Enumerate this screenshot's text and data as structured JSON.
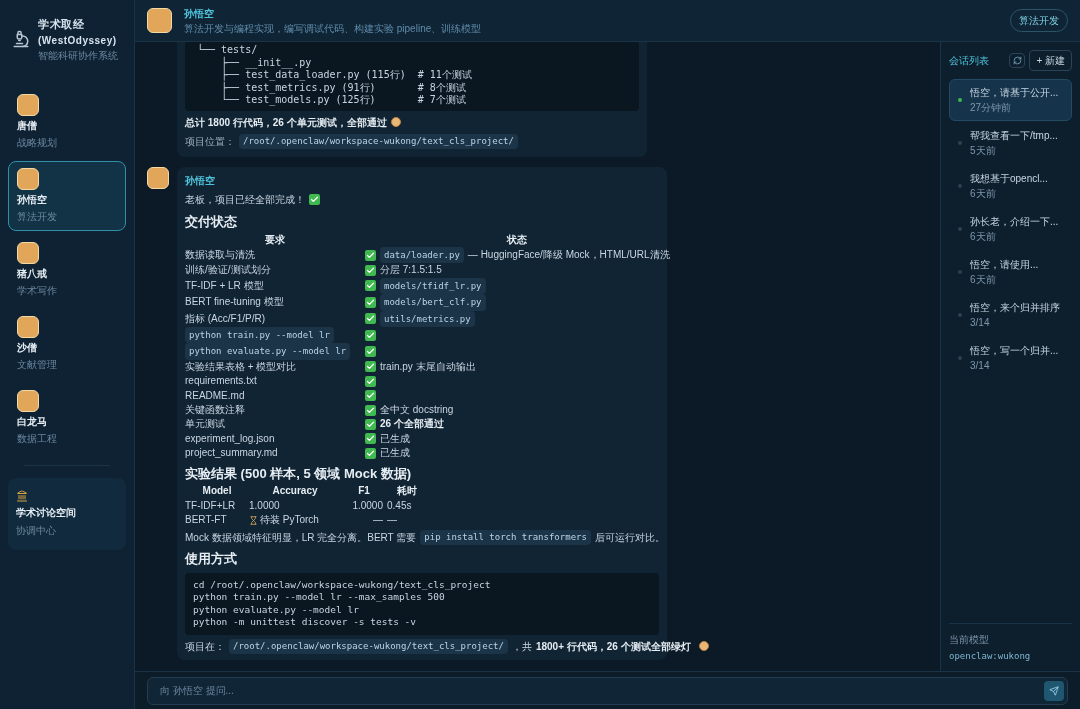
{
  "app": {
    "title": "学术取经",
    "subtitle": "(WestOdyssey)",
    "tagline": "智能科研协作系统"
  },
  "agents": [
    {
      "name": "唐僧",
      "role": "战略规划",
      "selected": false
    },
    {
      "name": "孙悟空",
      "role": "算法开发",
      "selected": true
    },
    {
      "name": "猪八戒",
      "role": "学术写作",
      "selected": false
    },
    {
      "name": "沙僧",
      "role": "文献管理",
      "selected": false
    },
    {
      "name": "白龙马",
      "role": "数据工程",
      "selected": false
    }
  ],
  "space": {
    "name": "学术讨论空间",
    "role": "协调中心"
  },
  "header": {
    "name": "孙悟空",
    "description": "算法开发与编程实现，编写调试代码、构建实验 pipeline、训练模型",
    "tag": "算法开发"
  },
  "previous_message": {
    "code_lines": [
      "└── tests/",
      "    ├── __init__.py",
      "    ├── test_data_loader.py (115行)  # 11个测试",
      "    ├── test_metrics.py (91行)       # 8个测试",
      "    └── test_models.py (125行)       # 7个测试"
    ],
    "summary": "总计 1800 行代码，26 个单元测试，全部通过",
    "location_label": "项目位置：",
    "location_path": "/root/.openclaw/workspace-wukong/text_cls_project/"
  },
  "message": {
    "sender": "孙悟空",
    "greeting": "老板，项目已经全部完成！",
    "delivery_title": "交付状态",
    "delivery_columns": [
      "要求",
      "状态"
    ],
    "delivery_rows": [
      {
        "requirement": {
          "kind": "text",
          "text": "数据读取与清洗"
        },
        "status": [
          {
            "kind": "code",
            "text": "data/loader.py"
          },
          {
            "kind": "text",
            "text": "— HuggingFace/降级 Mock，HTML/URL清洗"
          }
        ]
      },
      {
        "requirement": {
          "kind": "text",
          "text": "训练/验证/测试划分"
        },
        "status": [
          {
            "kind": "text",
            "text": "分层 7:1.5:1.5"
          }
        ]
      },
      {
        "requirement": {
          "kind": "text",
          "text": "TF-IDF + LR 模型"
        },
        "status": [
          {
            "kind": "code",
            "text": "models/tfidf_lr.py"
          }
        ]
      },
      {
        "requirement": {
          "kind": "text",
          "text": "BERT fine-tuning 模型"
        },
        "status": [
          {
            "kind": "code",
            "text": "models/bert_clf.py"
          }
        ]
      },
      {
        "requirement": {
          "kind": "text",
          "text": "指标 (Acc/F1/P/R)"
        },
        "status": [
          {
            "kind": "code",
            "text": "utils/metrics.py"
          }
        ]
      },
      {
        "requirement": {
          "kind": "code",
          "text": "python train.py --model lr"
        },
        "status": []
      },
      {
        "requirement": {
          "kind": "code",
          "text": "python evaluate.py --model lr"
        },
        "status": []
      },
      {
        "requirement": {
          "kind": "text",
          "text": "实验结果表格 + 模型对比"
        },
        "status": [
          {
            "kind": "text",
            "text": "train.py 末尾自动输出"
          }
        ]
      },
      {
        "requirement": {
          "kind": "text",
          "text": "requirements.txt"
        },
        "status": []
      },
      {
        "requirement": {
          "kind": "text",
          "text": "README.md"
        },
        "status": []
      },
      {
        "requirement": {
          "kind": "text",
          "text": "关键函数注释"
        },
        "status": [
          {
            "kind": "text",
            "text": "全中文 docstring"
          }
        ]
      },
      {
        "requirement": {
          "kind": "text",
          "text": "单元测试"
        },
        "status": [
          {
            "kind": "bold",
            "text": "26 个全部通过"
          }
        ]
      },
      {
        "requirement": {
          "kind": "text",
          "text": "experiment_log.json"
        },
        "status": [
          {
            "kind": "text",
            "text": "已生成"
          }
        ]
      },
      {
        "requirement": {
          "kind": "text",
          "text": "project_summary.md"
        },
        "status": [
          {
            "kind": "text",
            "text": "已生成"
          }
        ]
      }
    ],
    "results_title": "实验结果 (500 样本, 5 领域 Mock 数据)",
    "results_columns": [
      "Model",
      "Accuracy",
      "F1",
      "耗时"
    ],
    "results_rows": [
      {
        "kind": "done",
        "cells": [
          "TF-IDF+LR",
          "1.0000",
          "1.0000",
          "0.45s"
        ]
      },
      {
        "kind": "pending",
        "cells": [
          "BERT-FT",
          "待装 PyTorch",
          "—",
          "—"
        ]
      }
    ],
    "note": [
      {
        "kind": "text",
        "text": "Mock 数据领域特征明显，LR 完全分离。BERT 需要"
      },
      {
        "kind": "code",
        "text": "pip install torch transformers"
      },
      {
        "kind": "text",
        "text": "后可运行对比。"
      }
    ],
    "usage_title": "使用方式",
    "usage_code": [
      "cd /root/.openclaw/workspace-wukong/text_cls_project",
      "python train.py --model lr --max_samples 500",
      "python evaluate.py --model lr",
      "python -m unittest discover -s tests -v"
    ],
    "footer": [
      {
        "kind": "text",
        "text": "项目在："
      },
      {
        "kind": "code",
        "text": "/root/.openclaw/workspace-wukong/text_cls_project/"
      },
      {
        "kind": "text",
        "text": "，共"
      },
      {
        "kind": "bold",
        "text": "1800+ 行代码，26 个测试全部绿灯"
      }
    ]
  },
  "sessions": {
    "title": "会话列表",
    "new_label": "+ 新建",
    "items": [
      {
        "title": "悟空，请基于公开...",
        "time": "27分钟前",
        "selected": true
      },
      {
        "title": "帮我查看一下/tmp...",
        "time": "5天前",
        "selected": false
      },
      {
        "title": "我想基于opencl...",
        "time": "6天前",
        "selected": false
      },
      {
        "title": "孙长老，介绍一下...",
        "time": "6天前",
        "selected": false
      },
      {
        "title": "悟空，请使用...",
        "time": "6天前",
        "selected": false
      },
      {
        "title": "悟空，来个归并排序",
        "time": "3/14",
        "selected": false
      },
      {
        "title": "悟空，写一个归并...",
        "time": "3/14",
        "selected": false
      }
    ]
  },
  "model": {
    "label": "当前模型",
    "value": "openclaw:wukong"
  },
  "input": {
    "placeholder": "向 孙悟空 提问..."
  }
}
